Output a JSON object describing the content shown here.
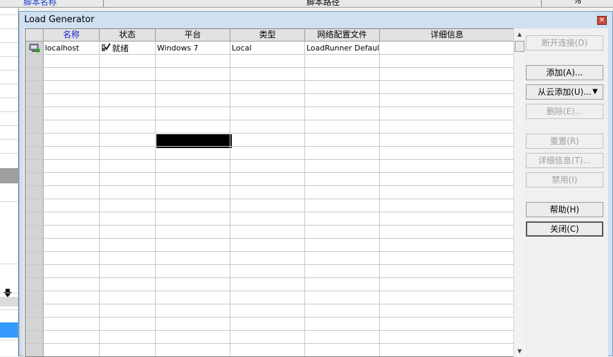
{
  "background": {
    "header_col1": "脚本名称",
    "header_col2": "脚本路径",
    "header_col3": "%",
    "scroll_down_icon": "arrow-down-icon"
  },
  "window": {
    "title": "Load Generator",
    "close_icon": "close-icon"
  },
  "grid": {
    "columns": [
      "名称",
      "状态",
      "平台",
      "类型",
      "网络配置文件",
      "详细信息"
    ],
    "rows": [
      {
        "name": "localhost",
        "status": "就绪",
        "platform": "Windows 7",
        "type": "Local",
        "network_profile": "LoadRunner Default",
        "details": ""
      }
    ],
    "row_icon": "load-generator-host-icon",
    "status_icon": "ready-check-icon",
    "empty_row_count": 23
  },
  "buttons": {
    "disconnect": "断开连接(D)",
    "add": "添加(A)...",
    "add_from_cloud": "从云添加(U)...",
    "delete": "删除(E)...",
    "reset": "重置(R)",
    "details": "详细信息(T)...",
    "disable": "禁用(I)",
    "help": "帮助(H)",
    "close": "关闭(C)"
  }
}
